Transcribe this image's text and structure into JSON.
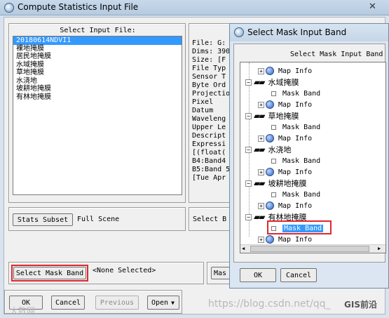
{
  "main_window": {
    "title": "Compute Statistics Input File",
    "select_input_label": "Select Input File:",
    "files": [
      {
        "label": "20180614NDVI1",
        "selected": true
      },
      {
        "label": "裸地掩膜",
        "selected": false
      },
      {
        "label": "居民地掩膜",
        "selected": false
      },
      {
        "label": "水域掩膜",
        "selected": false
      },
      {
        "label": "草地掩膜",
        "selected": false
      },
      {
        "label": "水浇地",
        "selected": false
      },
      {
        "label": "坡耕地掩膜",
        "selected": false
      },
      {
        "label": "有林地掩膜",
        "selected": false
      }
    ],
    "file_info": [
      "File: G:",
      "Dims: 390",
      "Size: [F",
      "File Typ",
      "Sensor T",
      "Byte Ord",
      "Projectio",
      "  Pixel",
      "  Datum",
      "Waveleng",
      "Upper Le",
      "Descript",
      "Expressi",
      "[(float(",
      "B4:Band4",
      "B5:Band 5",
      "[Tue Apr"
    ],
    "stats_subset_button": "Stats Subset",
    "stats_subset_value": "Full Scene",
    "select_by_label": "Select B",
    "select_mask_band_button": "Select Mask Band",
    "mask_selection_value": "<None Selected>",
    "mask_options_button_partial": "Mas",
    "buttons": {
      "ok": "OK",
      "cancel": "Cancel",
      "previous": "Previous",
      "open": "Open"
    }
  },
  "mask_dialog": {
    "title": "Select Mask Input Band",
    "header": "Select Mask Input Band",
    "tree": [
      {
        "kind": "info",
        "label": "Map Info"
      },
      {
        "kind": "file",
        "label": "水域掩膜"
      },
      {
        "kind": "band",
        "label": "Mask Band"
      },
      {
        "kind": "info",
        "label": "Map Info"
      },
      {
        "kind": "file",
        "label": "草地掩膜"
      },
      {
        "kind": "band",
        "label": "Mask Band"
      },
      {
        "kind": "info",
        "label": "Map Info"
      },
      {
        "kind": "file",
        "label": "水浇地"
      },
      {
        "kind": "band",
        "label": "Mask Band"
      },
      {
        "kind": "info",
        "label": "Map Info"
      },
      {
        "kind": "file",
        "label": "坡耕地掩膜"
      },
      {
        "kind": "band",
        "label": "Mask Band"
      },
      {
        "kind": "info",
        "label": "Map Info"
      },
      {
        "kind": "file",
        "label": "有林地掩膜"
      },
      {
        "kind": "band",
        "label": "Mask Band",
        "selected": true
      },
      {
        "kind": "info",
        "label": "Map Info"
      }
    ],
    "ok_button": "OK",
    "cancel_button": "Cancel"
  },
  "watermarks": {
    "left": "大数网",
    "url": "https://blog.csdn.net/qq_",
    "brand": "GIS前沿"
  },
  "icons": {
    "window_icon": "envi-globe-icon",
    "close": "close-icon",
    "tree_file": "mask-glasses-icon",
    "tree_info": "globe-icon",
    "tree_band": "band-square-icon"
  },
  "colors": {
    "highlight": "#3399ff",
    "annotation_red": "#e0282e",
    "title_bar": "#c5d6e8"
  }
}
